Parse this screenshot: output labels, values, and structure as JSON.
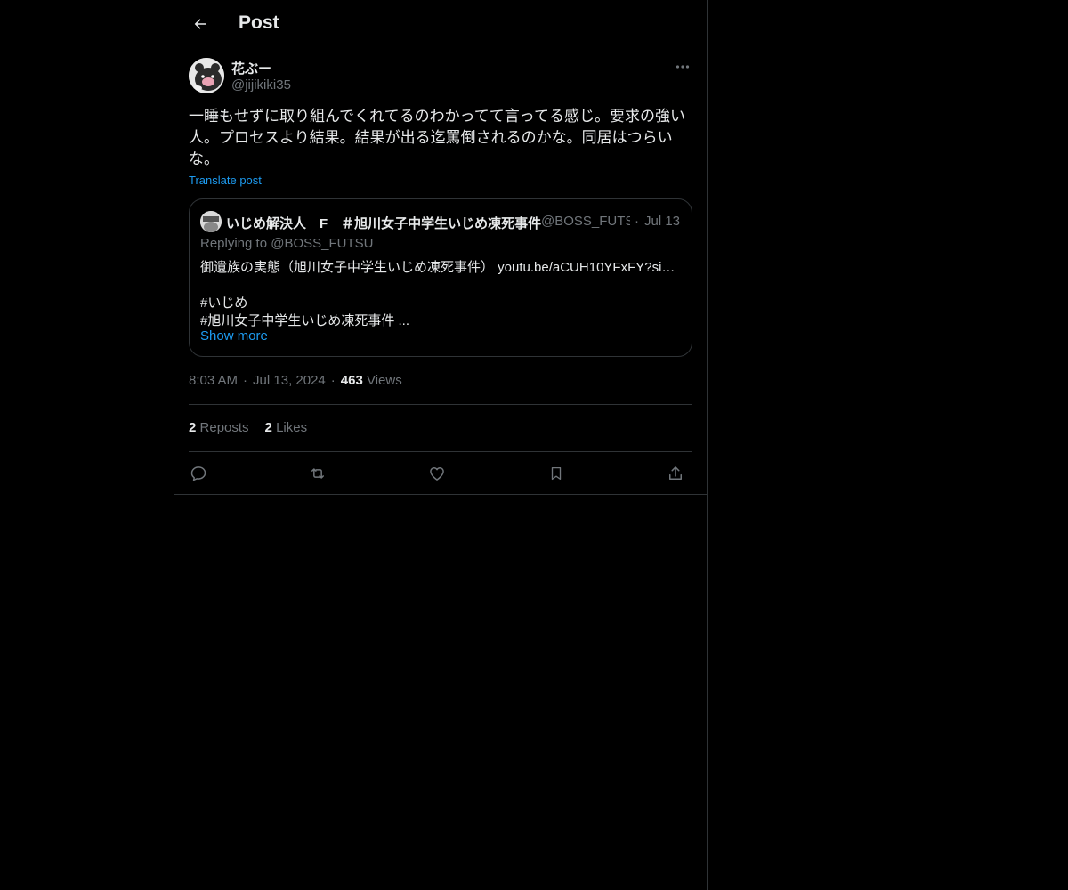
{
  "header": {
    "title": "Post"
  },
  "post": {
    "display_name": "花ぶー",
    "handle": "@jijikiki35",
    "text": "一睡もせずに取り組んでくれてるのわかってて言ってる感じ。要求の強い人。プロセスより結果。結果が出る迄罵倒されるのかな。同居はつらいな。",
    "translate_label": "Translate post",
    "time": "8:03 AM",
    "date": "Jul 13, 2024",
    "views_count": "463",
    "views_label": "Views",
    "reposts_count": "2",
    "reposts_label": "Reposts",
    "likes_count": "2",
    "likes_label": "Likes"
  },
  "quote": {
    "display_name": "いじめ解決人　F　＃旭川女子中学生いじめ凍死事件",
    "handle": "@BOSS_FUTSU",
    "date": "Jul 13",
    "replying_to": "Replying to @BOSS_FUTSU",
    "line1": "御遺族の実態（旭川女子中学生いじめ凍死事件） youtu.be/aCUH10YFxFY?si…",
    "line2": "#いじめ",
    "line3": "#旭川女子中学生いじめ凍死事件 ...",
    "show_more": "Show more"
  },
  "icons": {
    "back": "arrow-left-icon",
    "more": "more-horizontal-icon",
    "reply": "reply-icon",
    "repost": "repost-icon",
    "like": "heart-icon",
    "bookmark": "bookmark-icon",
    "share": "share-icon"
  },
  "colors": {
    "background": "#000000",
    "text": "#e7e9ea",
    "muted": "#71767b",
    "accent": "#1d9bf0",
    "border": "#2f3336"
  }
}
